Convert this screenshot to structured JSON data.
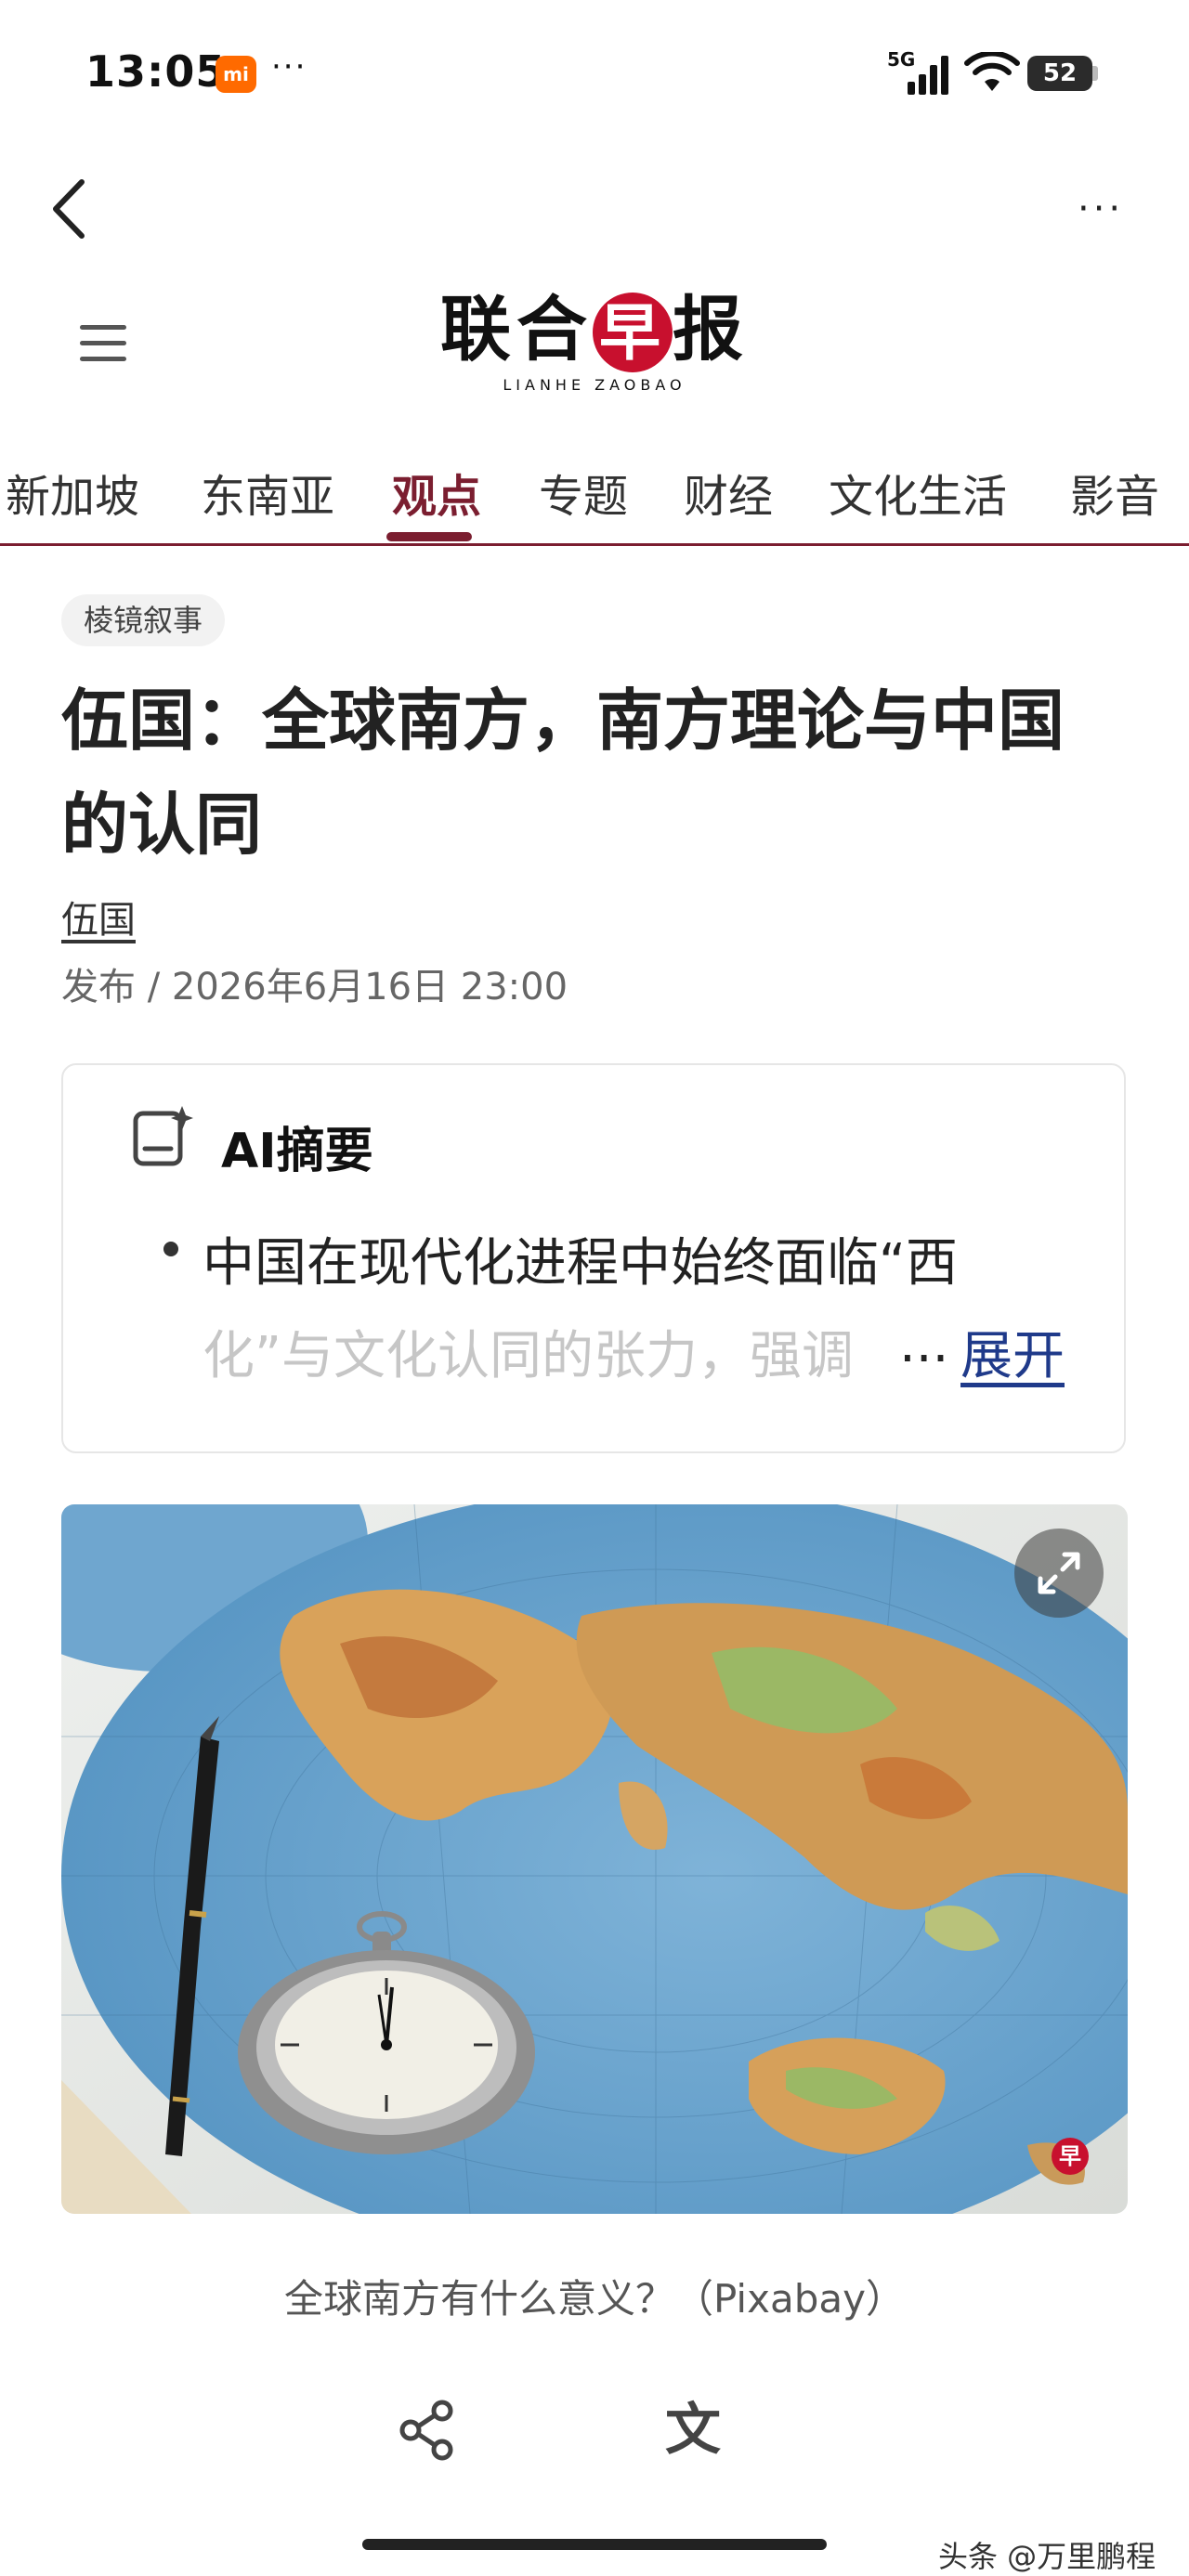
{
  "status_bar": {
    "time": "13:05",
    "app_badge": "mi",
    "more_dots": "···",
    "network": "5G",
    "battery": "52"
  },
  "header": {
    "back_icon": "chevron-left-icon",
    "more_icon": "more-horizontal-icon",
    "more_label": "···",
    "menu_icon": "hamburger-menu-icon",
    "logo": {
      "cn_before": "联合",
      "cn_highlight": "早",
      "cn_after": "报",
      "en": "LIANHE ZAOBAO"
    }
  },
  "nav": {
    "active_color": "#7b1e30",
    "tabs": [
      {
        "label": "新加坡"
      },
      {
        "label": "东南亚"
      },
      {
        "label": "观点",
        "active": true
      },
      {
        "label": "专题"
      },
      {
        "label": "财经"
      },
      {
        "label": "文化生活"
      },
      {
        "label": "影音"
      }
    ]
  },
  "article": {
    "tag": "棱镜叙事",
    "title": "伍国：全球南方，南方理论与中国的认同",
    "author": "伍国",
    "published": "发布 / 2026年6月16日 23:00"
  },
  "ai_summary": {
    "icon": "ai-document-sparkle-icon",
    "title": "AI摘要",
    "line1": "中国在现代化进程中始终面临“西",
    "line2": "化”与文化认同的张力，强调",
    "ellipsis": "...",
    "expand_label": "展开",
    "link_color": "#1f3a8a"
  },
  "media": {
    "expand_icon": "fullscreen-expand-icon",
    "brand_mark": "早",
    "caption": "全球南方有什么意义？（Pixabay）"
  },
  "actions": {
    "share_icon": "share-icon",
    "translate_icon": "translate-icon",
    "translate_glyph": "文"
  },
  "watermark": "头条 @万里鹏程"
}
